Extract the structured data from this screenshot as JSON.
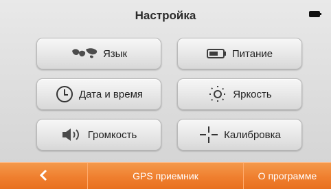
{
  "header": {
    "title": "Настройка",
    "battery_icon": "battery-icon"
  },
  "menu": {
    "language": {
      "label": "Язык",
      "icon": "world-map-icon"
    },
    "power": {
      "label": "Питание",
      "icon": "battery-power-icon"
    },
    "datetime": {
      "label": "Дата и время",
      "icon": "clock-icon"
    },
    "brightness": {
      "label": "Яркость",
      "icon": "sun-icon"
    },
    "volume": {
      "label": "Громкость",
      "icon": "speaker-icon"
    },
    "calibration": {
      "label": "Калибровка",
      "icon": "crosshair-icon"
    }
  },
  "footer": {
    "back_icon": "chevron-left-icon",
    "gps_label": "GPS приемник",
    "about_label": "О программе"
  },
  "colors": {
    "accent": "#ef7f2f",
    "background": "#dedede",
    "text": "#222222"
  }
}
